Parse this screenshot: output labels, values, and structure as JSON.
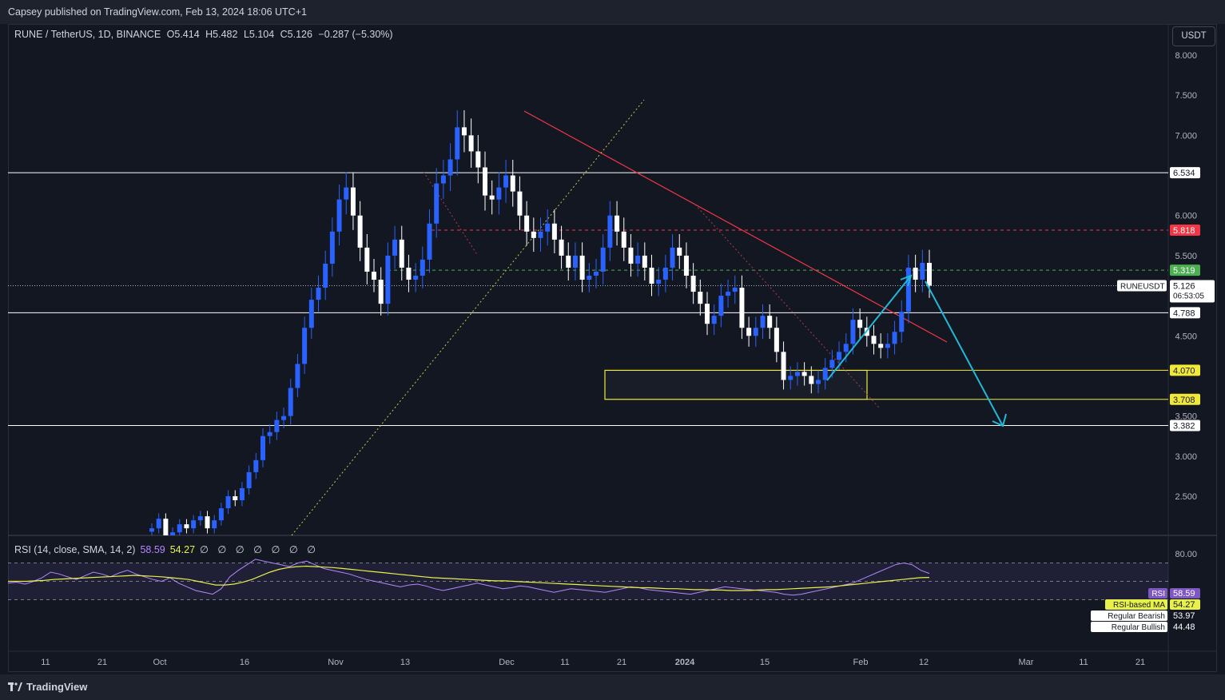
{
  "header": {
    "published": "Capsey published on TradingView.com, Feb 13, 2024 18:06 UTC+1"
  },
  "legend": {
    "symbol": "RUNE / TetherUS, 1D, BINANCE",
    "open": "O5.414",
    "high": "H5.482",
    "low": "L5.104",
    "close": "C5.126",
    "change": "−0.287 (−5.30%)"
  },
  "currency_button": "USDT",
  "rsi_legend": {
    "label": "RSI (14, close, SMA, 14, 2)",
    "rsi": "58.59",
    "ma": "54.27",
    "icons": "∅ ∅ ∅ ∅ ∅ ∅ ∅"
  },
  "footer": {
    "brand": "TradingView"
  },
  "colors": {
    "background": "#131722",
    "bull": "#2962ff",
    "bear": "#ffffff",
    "rsi": "#b388ff",
    "rsi_ma": "#e8f04a",
    "resistance": "#f23645",
    "support_zone": "#f0e93a",
    "projection": "#22b8d8"
  },
  "chart_data": [
    {
      "type": "candlestick",
      "symbol": "RUNE / TetherUS",
      "interval": "1D",
      "y_scale_labels": [
        "8.000",
        "7.500",
        "7.000",
        "6.000",
        "5.500",
        "4.500",
        "3.500",
        "3.000",
        "2.500"
      ],
      "x_tick_labels": [
        "11",
        "21",
        "Oct",
        "16",
        "Nov",
        "13",
        "Dec",
        "11",
        "21",
        "2024",
        "15",
        "Feb",
        "12",
        "Mar",
        "11",
        "21"
      ],
      "ylim": [
        2.05,
        8.15
      ],
      "price_badges": [
        {
          "value": "6.534",
          "style": "white"
        },
        {
          "value": "5.818",
          "style": "red"
        },
        {
          "value": "5.319",
          "style": "green"
        },
        {
          "value": "5.126",
          "style": "current",
          "label": "RUNEUSDT",
          "countdown": "06:53:05"
        },
        {
          "value": "4.788",
          "style": "white"
        },
        {
          "value": "4.070",
          "style": "yellow"
        },
        {
          "value": "3.708",
          "style": "yellow"
        },
        {
          "value": "3.382",
          "style": "white"
        }
      ],
      "horizontal_levels": [
        6.534,
        4.788,
        3.382
      ],
      "dashed_levels": {
        "red": 5.818,
        "green": 5.319
      },
      "current_price": 5.126,
      "support_zone": [
        3.708,
        4.07
      ],
      "closes": [
        2.1,
        2.22,
        2.0,
        2.05,
        2.15,
        2.1,
        2.2,
        2.25,
        2.1,
        2.2,
        2.35,
        2.5,
        2.45,
        2.6,
        2.8,
        2.95,
        3.25,
        3.3,
        3.45,
        3.5,
        3.85,
        4.15,
        4.6,
        4.95,
        5.1,
        5.4,
        5.8,
        6.2,
        6.35,
        6.0,
        5.6,
        5.3,
        5.2,
        4.9,
        5.5,
        5.7,
        5.35,
        5.2,
        5.25,
        5.45,
        5.9,
        6.4,
        6.5,
        6.7,
        7.1,
        7.0,
        6.8,
        6.6,
        6.25,
        6.2,
        6.35,
        6.5,
        6.3,
        6.0,
        5.8,
        5.72,
        5.8,
        5.9,
        5.7,
        5.5,
        5.35,
        5.5,
        5.2,
        5.25,
        5.3,
        5.6,
        6.0,
        5.8,
        5.6,
        5.4,
        5.5,
        5.35,
        5.15,
        5.2,
        5.35,
        5.6,
        5.5,
        5.25,
        5.05,
        4.9,
        4.65,
        4.75,
        5.0,
        5.05,
        5.1,
        4.6,
        4.5,
        4.6,
        4.75,
        4.6,
        4.3,
        3.95,
        4.0,
        4.05,
        4.0,
        3.9,
        3.95,
        4.1,
        4.2,
        4.3,
        4.4,
        4.7,
        4.6,
        4.5,
        4.4,
        4.35,
        4.4,
        4.55,
        4.8,
        5.35,
        5.2,
        5.41,
        5.126
      ],
      "rsi": [
        48,
        49,
        47,
        50,
        54,
        60,
        58,
        55,
        52,
        56,
        60,
        58,
        55,
        59,
        62,
        58,
        55,
        52,
        50,
        54,
        48,
        44,
        40,
        38,
        36,
        42,
        55,
        62,
        68,
        74,
        72,
        70,
        68,
        66,
        70,
        72,
        68,
        64,
        62,
        60,
        58,
        55,
        52,
        50,
        48,
        46,
        44,
        46,
        47,
        45,
        42,
        40,
        42,
        44,
        46,
        48,
        46,
        44,
        42,
        43,
        45,
        44,
        42,
        40,
        38,
        40,
        42,
        41,
        40,
        39,
        38,
        40,
        42,
        44,
        43,
        41,
        40,
        39,
        38,
        37,
        36,
        38,
        40,
        42,
        44,
        43,
        42,
        41,
        40,
        39,
        38,
        36,
        35,
        36,
        38,
        40,
        42,
        44,
        46,
        48,
        52,
        56,
        60,
        64,
        68,
        70,
        68,
        62,
        58.59
      ],
      "rsi_ma": [
        50,
        50,
        50,
        50.5,
        51,
        52,
        52.5,
        53,
        53.5,
        54,
        54.5,
        55,
        55.5,
        56,
        56.5,
        56,
        55.5,
        55,
        54,
        53,
        52,
        50,
        48,
        46,
        46,
        47,
        49,
        52,
        56,
        60,
        63,
        65,
        66,
        66.5,
        66,
        65.5,
        65,
        64,
        63,
        62,
        61,
        60,
        59,
        58,
        57,
        56,
        55,
        54,
        53.5,
        53,
        52.5,
        52,
        51.5,
        51,
        50.5,
        50.5,
        50,
        49.5,
        49,
        48.5,
        48,
        47.5,
        47,
        46.5,
        46,
        45.5,
        45,
        44.5,
        44,
        43.5,
        43,
        43,
        42.5,
        42,
        42,
        41.5,
        41,
        41,
        40.5,
        40.5,
        40,
        40,
        40,
        40.5,
        41,
        41,
        41.5,
        42,
        42.5,
        43,
        43.5,
        44,
        45,
        46,
        47,
        48,
        49,
        50,
        51,
        52,
        53,
        54,
        54.27
      ],
      "rsi_scale_labels": [
        "80.00"
      ],
      "rsi_badges": [
        {
          "label": "RSI",
          "value": "58.59"
        },
        {
          "label": "RSI-based MA",
          "value": "54.27"
        },
        {
          "label": "Regular Bearish",
          "value": "53.97"
        },
        {
          "label": "Regular Bullish",
          "value": "44.48"
        }
      ]
    }
  ]
}
